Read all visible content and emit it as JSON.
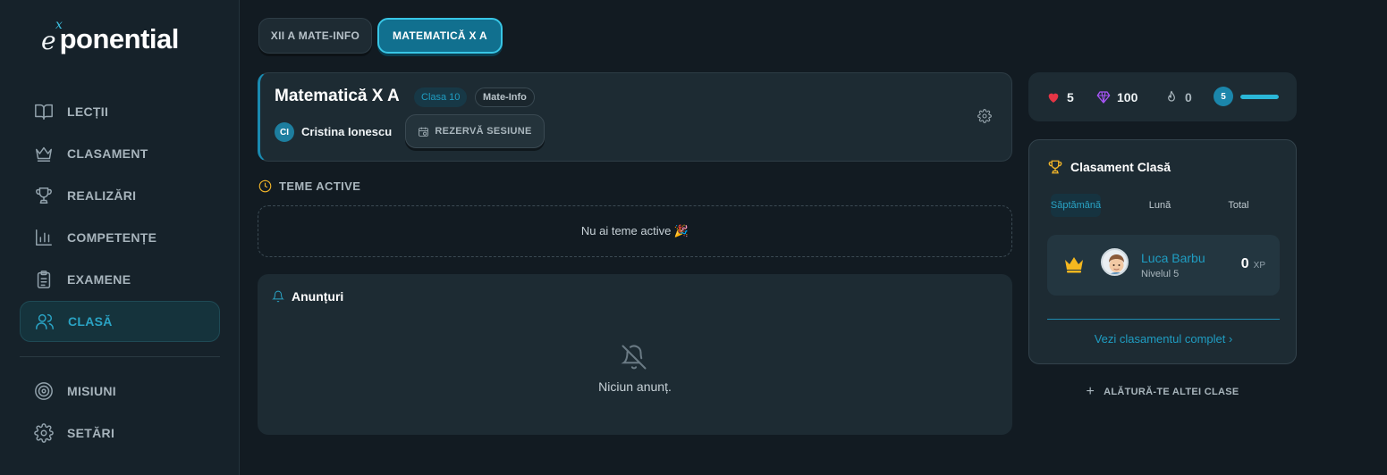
{
  "logo": {
    "e": "e",
    "x": "x",
    "rest": "ponential"
  },
  "nav": {
    "items": [
      {
        "label": "LECȚII",
        "icon": "book-icon"
      },
      {
        "label": "CLASAMENT",
        "icon": "crown-icon"
      },
      {
        "label": "REALIZĂRI",
        "icon": "trophy-icon"
      },
      {
        "label": "COMPETENȚE",
        "icon": "bar-chart-icon"
      },
      {
        "label": "EXAMENE",
        "icon": "clipboard-icon"
      },
      {
        "label": "CLASĂ",
        "icon": "users-icon",
        "active": true
      },
      {
        "label": "MISIUNI",
        "icon": "target-icon"
      },
      {
        "label": "SETĂRI",
        "icon": "gear-icon"
      }
    ]
  },
  "tabs": [
    {
      "label": "XII A MATE-INFO",
      "active": false
    },
    {
      "label": "MATEMATICĂ X A",
      "active": true
    }
  ],
  "class_card": {
    "title": "Matematică X A",
    "grade_badge": "Clasa 10",
    "profile_badge": "Mate-Info",
    "teacher_initials": "CI",
    "teacher_name": "Cristina Ionescu",
    "book_button": "REZERVĂ SESIUNE"
  },
  "homework": {
    "title": "TEME ACTIVE",
    "empty_text": "Nu ai teme active 🎉"
  },
  "announcements": {
    "title": "Anunțuri",
    "empty_text": "Niciun anunț."
  },
  "stats": {
    "hearts": "5",
    "gems": "100",
    "streak": "0",
    "level": "5",
    "level_progress": 1.0,
    "colors": {
      "heart": "#e53545",
      "gem": "#a855f7",
      "accent": "#2aa3c4"
    }
  },
  "leaderboard": {
    "title": "Clasament Clasă",
    "periods": [
      "Săptămână",
      "Lună",
      "Total"
    ],
    "active_period": "Săptămână",
    "entries": [
      {
        "name": "Luca Barbu",
        "level": "Nivelul 5",
        "xp": "0",
        "xp_unit": "XP"
      }
    ],
    "link": "Vezi clasamentul complet ›"
  },
  "join": {
    "label": "ALĂTURĂ-TE ALTEI CLASE"
  }
}
